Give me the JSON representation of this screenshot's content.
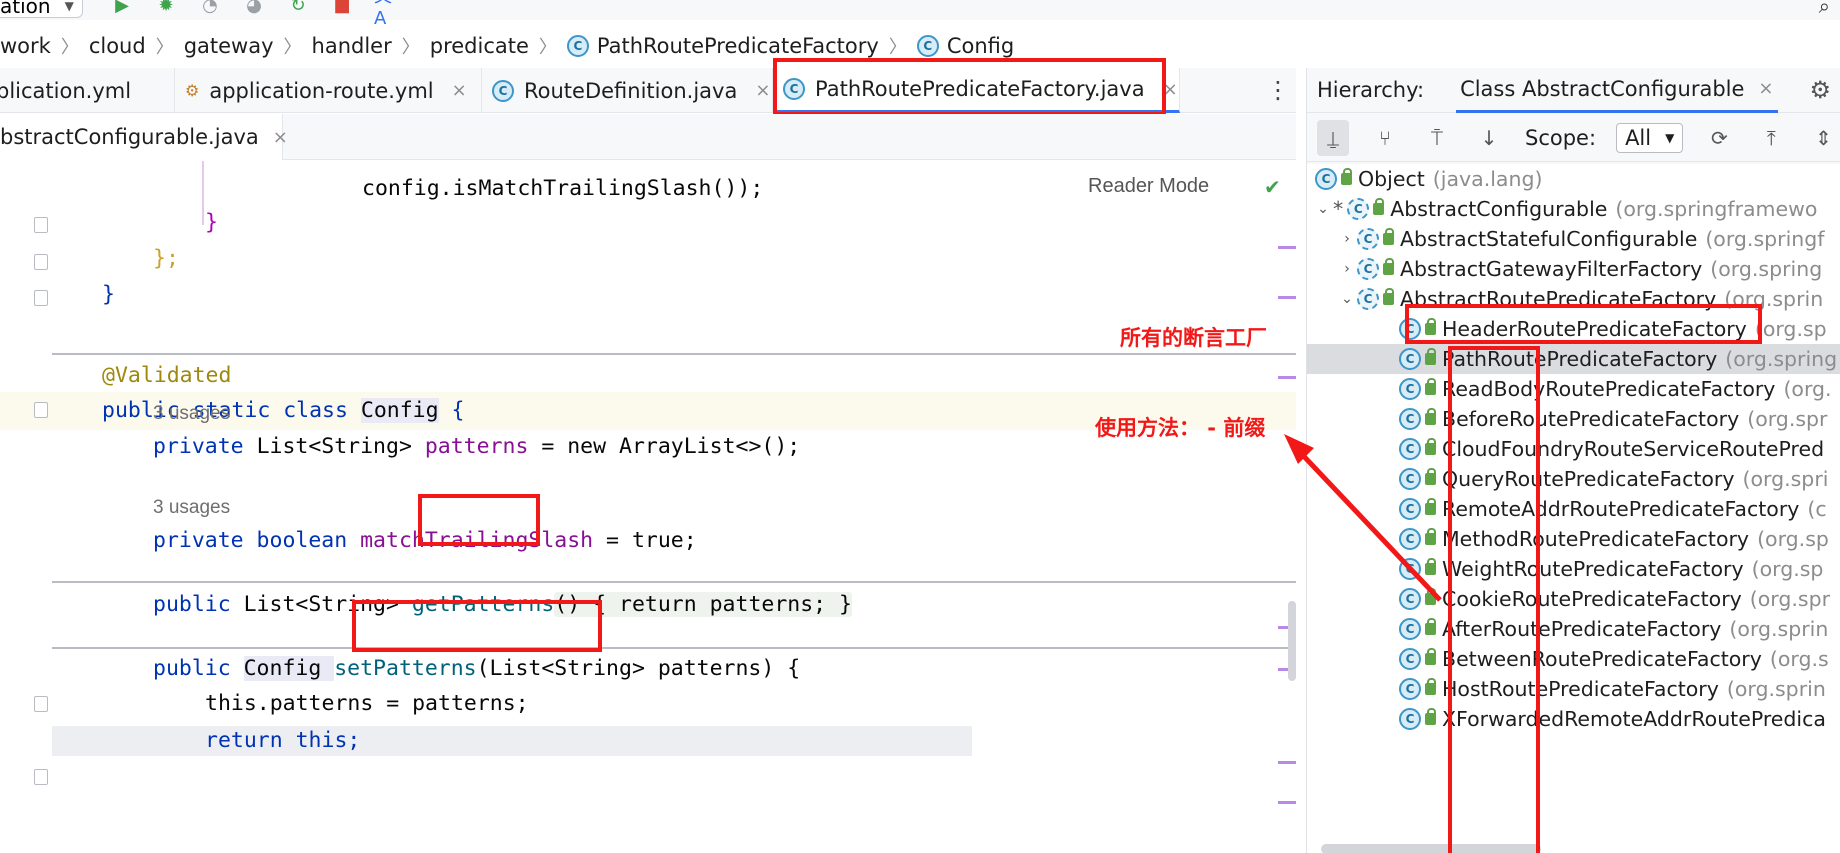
{
  "toolbar": {
    "run_config": "ation",
    "icons": [
      "run-icon",
      "debug-icon",
      "coverage-icon",
      "profile-icon",
      "run-more-icon",
      "stop-icon",
      "translate-icon",
      "search-icon"
    ]
  },
  "breadcrumb": [
    "work",
    "cloud",
    "gateway",
    "handler",
    "predicate",
    "PathRoutePredicateFactory",
    "Config"
  ],
  "tabs": [
    {
      "label": "plication.yml"
    },
    {
      "label": "application-route.yml"
    },
    {
      "label": "RouteDefinition.java"
    },
    {
      "label": "PathRoutePredicateFactory.java"
    }
  ],
  "tabs2": [
    {
      "label": "bstractConfigurable.java"
    }
  ],
  "close_glyph": "×",
  "editor": {
    "reader_mode": "Reader Mode",
    "usages_1": "3 usages",
    "usages_2": "3 usages",
    "lines": {
      "l1": "config.isMatchTrailingSlash());",
      "l2": "}",
      "l3": "};",
      "l4": "}",
      "ann": "@Validated",
      "cls_kw": "public static class ",
      "cls_name": "Config",
      "cls_brace": " {",
      "f1_kw": "private ",
      "f1_type": "List<String> ",
      "f1_name": "patterns",
      "f1_rest": " = new ArrayList<>();",
      "f2_kw": "private boolean ",
      "f2_name": "matchTrailingSlash",
      "f2_rest": " = true;",
      "m1_kw": "public ",
      "m1_type": "List<String> ",
      "m1_name": "getPatterns",
      "m1_body": "() { return patterns; }",
      "m2_kw": "public ",
      "m2_type": "Config ",
      "m2_name": "setPatterns",
      "m2_sig": "(List<String> patterns) {",
      "m2_l1": "this.patterns = patterns;",
      "m2_l2": "return this;"
    }
  },
  "annotations": {
    "all_factories": "所有的断言工厂",
    "usage": "使用方法： - 前缀"
  },
  "hierarchy": {
    "title": "Hierarchy:",
    "tab": "Class AbstractConfigurable",
    "scope_label": "Scope:",
    "scope_value": "All",
    "nodes": [
      {
        "name": "Object",
        "pkg": "(java.lang)"
      },
      {
        "name": "AbstractConfigurable",
        "pkg": "(org.springframewo"
      },
      {
        "name": "AbstractStatefulConfigurable",
        "pkg": "(org.springf"
      },
      {
        "name": "AbstractGatewayFilterFactory",
        "pkg": "(org.spring"
      },
      {
        "name": "AbstractRoutePredicateFactory",
        "pkg": "(org.sprin"
      },
      {
        "name": "HeaderRoutePredicateFactory",
        "pkg": "(org.sp"
      },
      {
        "name": "PathRoutePredicateFactory",
        "pkg": "(org.spring"
      },
      {
        "name": "ReadBodyRoutePredicateFactory",
        "pkg": "(org."
      },
      {
        "name": "BeforeRoutePredicateFactory",
        "pkg": "(org.spr"
      },
      {
        "name": "CloudFoundryRouteServiceRoutePred",
        "pkg": ""
      },
      {
        "name": "QueryRoutePredicateFactory",
        "pkg": "(org.spri"
      },
      {
        "name": "RemoteAddrRoutePredicateFactory",
        "pkg": "(c"
      },
      {
        "name": "MethodRoutePredicateFactory",
        "pkg": "(org.sp"
      },
      {
        "name": "WeightRoutePredicateFactory",
        "pkg": "(org.sp"
      },
      {
        "name": "CookieRoutePredicateFactory",
        "pkg": "(org.spr"
      },
      {
        "name": "AfterRoutePredicateFactory",
        "pkg": "(org.sprin"
      },
      {
        "name": "BetweenRoutePredicateFactory",
        "pkg": "(org.s"
      },
      {
        "name": "HostRoutePredicateFactory",
        "pkg": "(org.sprin"
      },
      {
        "name": "XForwardedRemoteAddrRoutePredica",
        "pkg": ""
      }
    ]
  },
  "colors": {
    "annotation_red": "#f21818",
    "keyword": "#0033b3",
    "field": "#871094",
    "accent": "#3574f0"
  }
}
